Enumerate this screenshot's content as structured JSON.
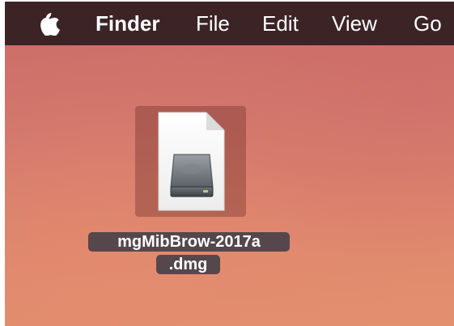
{
  "menubar": {
    "apple_icon": "apple-logo-icon",
    "items": [
      {
        "label": "Finder",
        "bold": true
      },
      {
        "label": "File"
      },
      {
        "label": "Edit"
      },
      {
        "label": "View"
      },
      {
        "label": "Go"
      }
    ]
  },
  "desktop": {
    "file": {
      "icon": "dmg-disk-image-icon",
      "name_line_1": "mgMibBrow-2017a",
      "name_line_2": ".dmg"
    }
  },
  "colors": {
    "menubar": "#3c2426",
    "desktop": "#d57a6e",
    "selection": "#6e2d28"
  }
}
